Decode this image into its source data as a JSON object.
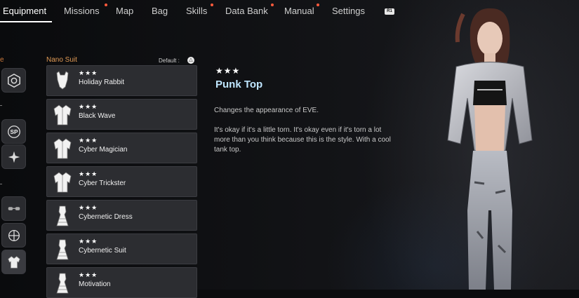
{
  "nav": {
    "tabs": [
      "Equipment",
      "Missions",
      "Map",
      "Bag",
      "Skills",
      "Data Bank",
      "Manual",
      "Settings"
    ],
    "next_tab_button": "R1"
  },
  "sidebar": {
    "fragment_label": "e",
    "icons": [
      "exospine-icon",
      "sp-icon",
      "gear-core-icon",
      "hairpin-icon",
      "earring-icon",
      "outfit-icon"
    ],
    "sp_label": "SP"
  },
  "list": {
    "title": "Nano Suit",
    "sort_label": "Default :",
    "sort_button": "△",
    "items": [
      {
        "stars": "★★★",
        "name": "Holiday Rabbit",
        "icon": "bodysuit-icon"
      },
      {
        "stars": "★★★",
        "name": "Black Wave",
        "icon": "jacket-icon"
      },
      {
        "stars": "★★★",
        "name": "Cyber Magician",
        "icon": "jacket-icon"
      },
      {
        "stars": "★★★",
        "name": "Cyber Trickster",
        "icon": "jacket-icon"
      },
      {
        "stars": "★★★",
        "name": "Cybernetic Dress",
        "icon": "dress-icon"
      },
      {
        "stars": "★★★",
        "name": "Cybernetic Suit",
        "icon": "dress-icon"
      },
      {
        "stars": "★★★",
        "name": "Motivation",
        "icon": "dress-icon"
      }
    ]
  },
  "details": {
    "stars": "★★★",
    "title": "Punk Top",
    "description": "Changes the appearance of EVE.",
    "lore": "It's okay if it's a little torn. It's okay even if it's torn a lot more than you think because this is the style. With a cool tank top."
  },
  "colors": {
    "accent_orange": "#e09a55",
    "title_blue": "#bfe6ff",
    "notification_red": "#ff5a3c",
    "item_bg": "#2c2d31"
  }
}
